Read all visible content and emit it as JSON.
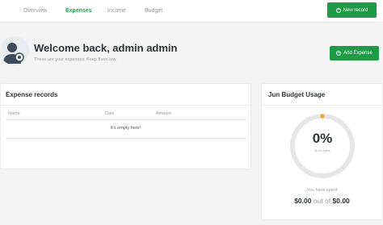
{
  "nav": {
    "tabs": [
      {
        "label": "Overview",
        "active": false
      },
      {
        "label": "Expenses",
        "active": true
      },
      {
        "label": "Income",
        "active": false
      },
      {
        "label": "Budget",
        "active": false
      }
    ],
    "new_record_label": "New record"
  },
  "welcome": {
    "title": "Welcome back, admin admin",
    "subtitle": "These are your expenses. Keep them low.",
    "add_expense_label": "Add Expense"
  },
  "expenses": {
    "title": "Expense records",
    "columns": [
      "Name",
      "Date",
      "Amount"
    ],
    "empty_text": "It's empty here!"
  },
  "budget": {
    "title": "Jun Budget Usage",
    "percent_text": "0%",
    "percent_value": 0,
    "donut_sub": "$0.00 Spent",
    "spent_label": "You have spent",
    "spent_amount": "$0.00",
    "of_text": "out of",
    "total_amount": "$0.00"
  },
  "colors": {
    "accent": "#1f9a45",
    "indicator": "#f5a623",
    "track": "#e6e6e6"
  }
}
